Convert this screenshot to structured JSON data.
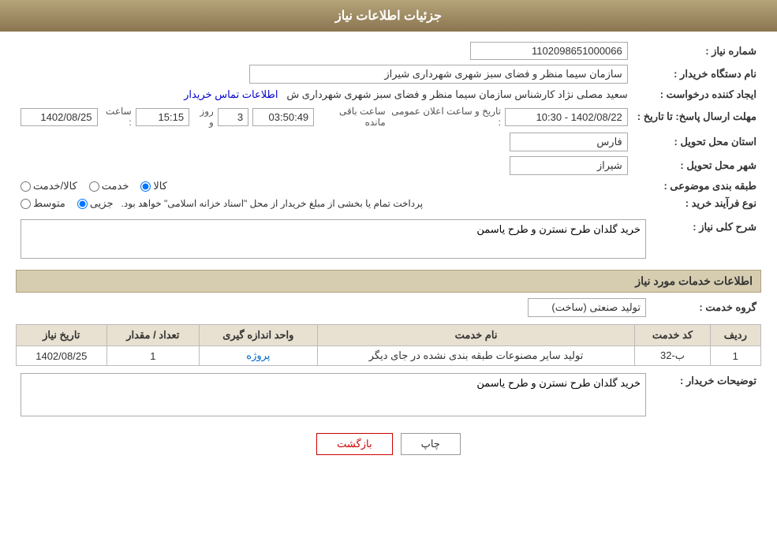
{
  "header": {
    "title": "جزئیات اطلاعات نیاز"
  },
  "fields": {
    "need_number_label": "شماره نیاز :",
    "need_number_value": "1102098651000066",
    "buyer_org_label": "نام دستگاه خریدار :",
    "buyer_org_value": "سازمان سیما منظر و فضای سبز شهری شهرداری شیراز",
    "creator_label": "ایجاد کننده درخواست :",
    "creator_value": "سعید مصلی نژاد کارشناس سازمان سیما منظر و فضای سبز شهری شهرداری ش",
    "contact_link": "اطلاعات تماس خریدار",
    "deadline_label": "مهلت ارسال پاسخ: تا تاریخ :",
    "deadline_date": "1402/08/25",
    "deadline_time_label": "ساعت :",
    "deadline_time": "15:15",
    "deadline_days_label": "روز و",
    "deadline_days": "3",
    "deadline_remaining_label": "ساعت باقی مانده",
    "deadline_remaining": "03:50:49",
    "announce_label": "تاریخ و ساعت اعلان عمومی :",
    "announce_value": "1402/08/22 - 10:30",
    "province_label": "استان محل تحویل :",
    "province_value": "فارس",
    "city_label": "شهر محل تحویل :",
    "city_value": "شیراز",
    "category_label": "طبقه بندی موضوعی :",
    "category_options": [
      "کالا",
      "خدمت",
      "کالا/خدمت"
    ],
    "category_selected": "کالا",
    "purchase_type_label": "نوع فرآیند خرید :",
    "purchase_note": "پرداخت تمام یا بخشی از مبلغ خریدار از محل \"اسناد خزانه اسلامی\" خواهد بود.",
    "purchase_options": [
      "جزیی",
      "متوسط"
    ],
    "purchase_selected": "جزیی",
    "need_description_label": "شرح کلی نیاز :",
    "need_description_value": "خرید گلدان طرح نسترن و طرح یاسمن",
    "services_section_title": "اطلاعات خدمات مورد نیاز",
    "service_group_label": "گروه خدمت :",
    "service_group_value": "تولید صنعتی (ساخت)",
    "table_headers": {
      "row_num": "ردیف",
      "service_code": "کد خدمت",
      "service_name": "نام خدمت",
      "unit": "واحد اندازه گیری",
      "quantity": "تعداد / مقدار",
      "date": "تاریخ نیاز"
    },
    "table_rows": [
      {
        "row_num": "1",
        "service_code": "ب-32",
        "service_name": "تولید سایر مصنوعات طبقه بندی نشده در جای دیگر",
        "unit": "پروژه",
        "quantity": "1",
        "date": "1402/08/25"
      }
    ],
    "buyer_desc_label": "توضیحات خریدار :",
    "buyer_desc_value": "خرید گلدان طرح نسترن و طرح یاسمن"
  },
  "buttons": {
    "print": "چاپ",
    "back": "بازگشت"
  }
}
